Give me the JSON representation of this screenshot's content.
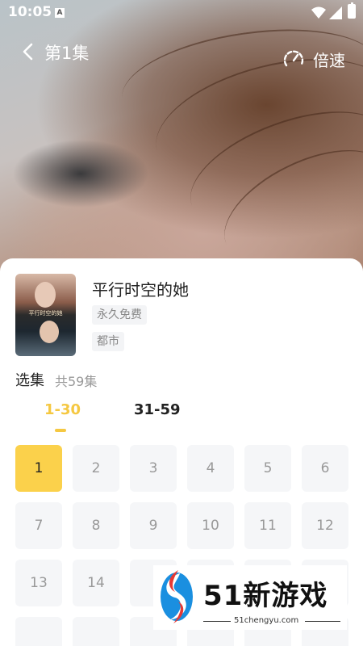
{
  "status_bar": {
    "time": "10:05",
    "notif_letter": "A"
  },
  "player": {
    "episode_title": "第1集",
    "speed_label": "倍速"
  },
  "drama": {
    "cover_text": "平行时空的她",
    "title": "平行时空的她",
    "tags": [
      "永久免费",
      "都市"
    ]
  },
  "episodes": {
    "section_label": "选集",
    "count_text": "共59集",
    "tabs": [
      "1-30",
      "31-59"
    ],
    "active_tab": 0,
    "items": [
      "1",
      "2",
      "3",
      "4",
      "5",
      "6",
      "7",
      "8",
      "9",
      "10",
      "11",
      "12",
      "13",
      "14",
      "",
      "",
      "",
      "",
      "",
      "",
      "",
      "",
      "",
      ""
    ],
    "active_episode": "1"
  },
  "watermark": {
    "brand": "51新游戏",
    "url": "51chengyu.com"
  },
  "colors": {
    "accent": "#fbd14b",
    "accent_text": "#f5c842",
    "tile_bg": "#f5f6f8"
  }
}
